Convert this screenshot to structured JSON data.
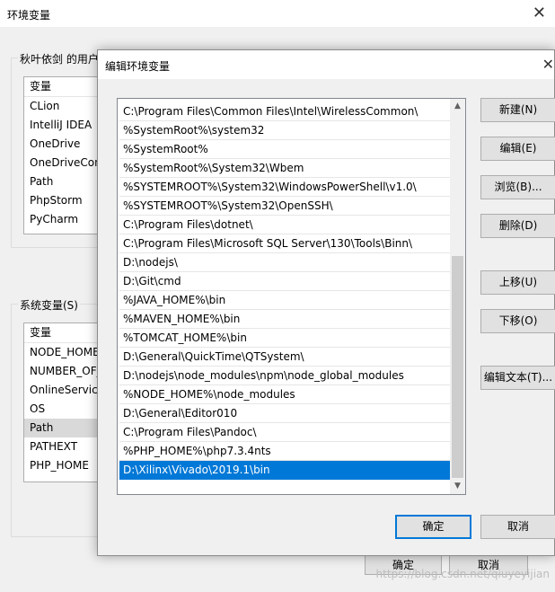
{
  "back_window": {
    "title": "环境变量",
    "user_group_label": "秋叶依剑 的用户",
    "user_list": {
      "header": "变量",
      "rows": [
        "CLion",
        "IntelliJ IDEA",
        "OneDrive",
        "OneDriveCon",
        "Path",
        "PhpStorm",
        "PyCharm"
      ]
    },
    "system_group_label": "系统变量(S)",
    "system_list": {
      "header": "变量",
      "rows": [
        "NODE_HOME",
        "NUMBER_OF_",
        "OnlineService",
        "OS",
        "Path",
        "PATHEXT",
        "PHP_HOME"
      ],
      "selected_index": 4
    },
    "ok_label": "确定",
    "cancel_label": "取消"
  },
  "dialog": {
    "title": "编辑环境变量",
    "paths": [
      "C:\\Program Files\\Common Files\\Intel\\WirelessCommon\\",
      "%SystemRoot%\\system32",
      "%SystemRoot%",
      "%SystemRoot%\\System32\\Wbem",
      "%SYSTEMROOT%\\System32\\WindowsPowerShell\\v1.0\\",
      "%SYSTEMROOT%\\System32\\OpenSSH\\",
      "C:\\Program Files\\dotnet\\",
      "C:\\Program Files\\Microsoft SQL Server\\130\\Tools\\Binn\\",
      "D:\\nodejs\\",
      "D:\\Git\\cmd",
      "%JAVA_HOME%\\bin",
      "%MAVEN_HOME%\\bin",
      "%TOMCAT_HOME%\\bin",
      "D:\\General\\QuickTime\\QTSystem\\",
      "D:\\nodejs\\node_modules\\npm\\node_global_modules",
      "%NODE_HOME%\\node_modules",
      "D:\\General\\Editor010",
      "C:\\Program Files\\Pandoc\\",
      "%PHP_HOME%\\php7.3.4nts",
      "D:\\Xilinx\\Vivado\\2019.1\\bin"
    ],
    "selected_index": 19,
    "buttons": {
      "new": "新建(N)",
      "edit": "编辑(E)",
      "browse": "浏览(B)...",
      "delete": "删除(D)",
      "move_up": "上移(U)",
      "move_down": "下移(O)",
      "edit_text": "编辑文本(T)..."
    },
    "ok_label": "确定",
    "cancel_label": "取消"
  },
  "watermark": "https://blog.csdn.net/qiuyeyijian",
  "colors": {
    "selection": "#0078d7",
    "dialog_bg": "#f0f0f0"
  }
}
